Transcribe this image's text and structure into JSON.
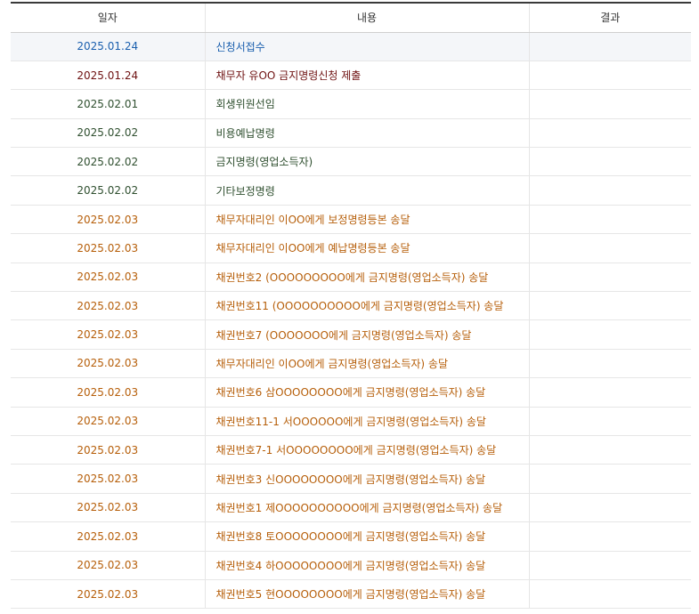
{
  "header": {
    "date": "일자",
    "content": "내용",
    "result": "결과"
  },
  "colors": {
    "blue": "#1a5fae",
    "maroon": "#6e1111",
    "green": "#2f4f2f",
    "orange": "#b65e09",
    "highlight_bg": "#f4f6f9"
  },
  "rows": [
    {
      "date": "2025.01.24",
      "content": "신청서접수",
      "result": "",
      "color": "blue",
      "highlight": true
    },
    {
      "date": "2025.01.24",
      "content": "채무자 유OO 금지명령신청 제출",
      "result": "",
      "color": "maroon"
    },
    {
      "date": "2025.02.01",
      "content": "회생위원선임",
      "result": "",
      "color": "green"
    },
    {
      "date": "2025.02.02",
      "content": "비용예납명령",
      "result": "",
      "color": "green"
    },
    {
      "date": "2025.02.02",
      "content": "금지명령(영업소득자)",
      "result": "",
      "color": "green"
    },
    {
      "date": "2025.02.02",
      "content": "기타보정명령",
      "result": "",
      "color": "green"
    },
    {
      "date": "2025.02.03",
      "content": "채무자대리인 이OO에게 보정명령등본 송달",
      "result": "",
      "color": "orange"
    },
    {
      "date": "2025.02.03",
      "content": "채무자대리인 이OO에게 예납명령등본 송달",
      "result": "",
      "color": "orange"
    },
    {
      "date": "2025.02.03",
      "content": "채권번호2 (OOOOOOOOO에게 금지명령(영업소득자) 송달",
      "result": "",
      "color": "orange"
    },
    {
      "date": "2025.02.03",
      "content": "채권번호11 (OOOOOOOOOO에게 금지명령(영업소득자) 송달",
      "result": "",
      "color": "orange"
    },
    {
      "date": "2025.02.03",
      "content": "채권번호7 (OOOOOOO에게 금지명령(영업소득자) 송달",
      "result": "",
      "color": "orange"
    },
    {
      "date": "2025.02.03",
      "content": "채무자대리인 이OO에게 금지명령(영업소득자) 송달",
      "result": "",
      "color": "orange"
    },
    {
      "date": "2025.02.03",
      "content": "채권번호6 삼OOOOOOOO에게 금지명령(영업소득자) 송달",
      "result": "",
      "color": "orange"
    },
    {
      "date": "2025.02.03",
      "content": "채권번호11-1 서OOOOOO에게 금지명령(영업소득자) 송달",
      "result": "",
      "color": "orange"
    },
    {
      "date": "2025.02.03",
      "content": "채권번호7-1 서OOOOOOOO에게 금지명령(영업소득자) 송달",
      "result": "",
      "color": "orange"
    },
    {
      "date": "2025.02.03",
      "content": "채권번호3 신OOOOOOOO에게 금지명령(영업소득자) 송달",
      "result": "",
      "color": "orange"
    },
    {
      "date": "2025.02.03",
      "content": "채권번호1 제OOOOOOOOOO에게 금지명령(영업소득자) 송달",
      "result": "",
      "color": "orange"
    },
    {
      "date": "2025.02.03",
      "content": "채권번호8 토OOOOOOOO에게 금지명령(영업소득자) 송달",
      "result": "",
      "color": "orange"
    },
    {
      "date": "2025.02.03",
      "content": "채권번호4 하OOOOOOOO에게 금지명령(영업소득자) 송달",
      "result": "",
      "color": "orange"
    },
    {
      "date": "2025.02.03",
      "content": "채권번호5 현OOOOOOOO에게 금지명령(영업소득자) 송달",
      "result": "",
      "color": "orange"
    }
  ]
}
